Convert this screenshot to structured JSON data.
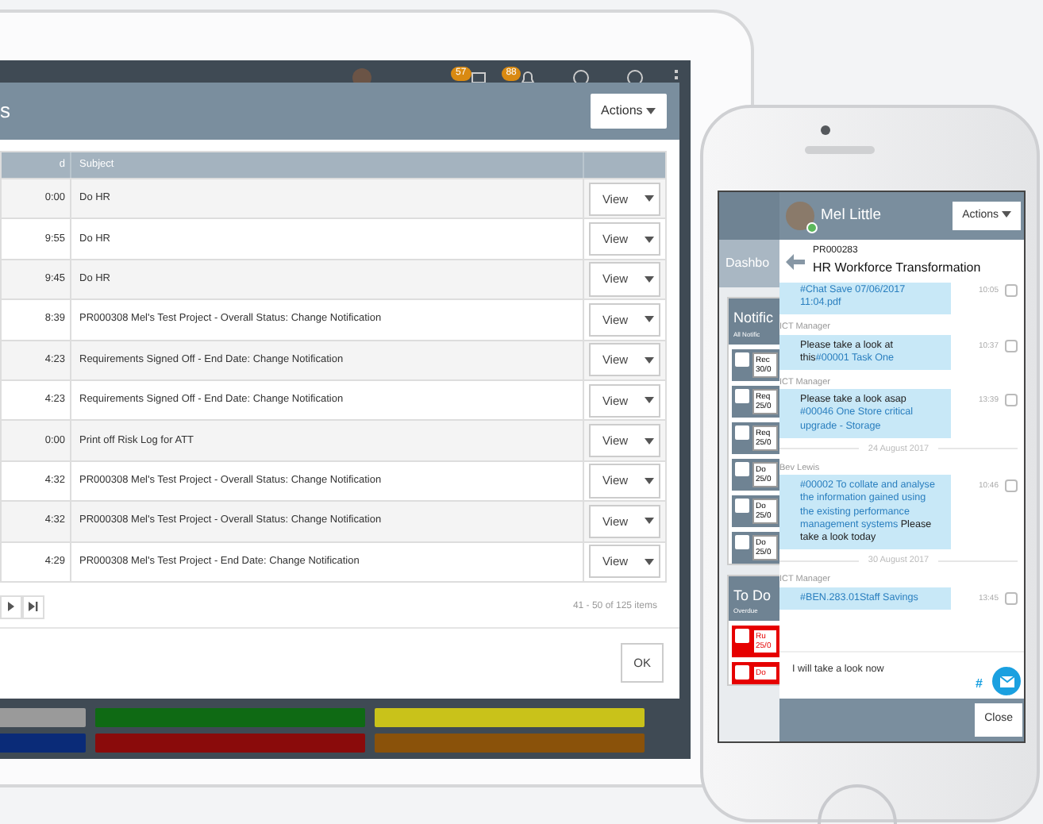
{
  "tablet": {
    "top_bar": {
      "badges": [
        "57",
        "88"
      ]
    },
    "modal": {
      "title": "s",
      "actions_button": "Actions",
      "columns": [
        "d",
        "Subject"
      ],
      "rows": [
        {
          "time": "0:00",
          "subject": "Do HR",
          "button": "View"
        },
        {
          "time": "9:55",
          "subject": "Do HR",
          "button": "View"
        },
        {
          "time": "9:45",
          "subject": "Do HR",
          "button": "View"
        },
        {
          "time": "8:39",
          "subject": "PR000308 Mel's Test Project - Overall Status: Change Notification",
          "button": "View"
        },
        {
          "time": "4:23",
          "subject": "Requirements Signed Off - End Date: Change Notification",
          "button": "View"
        },
        {
          "time": "4:23",
          "subject": "Requirements Signed Off - End Date: Change Notification",
          "button": "View"
        },
        {
          "time": "0:00",
          "subject": "Print off Risk Log for ATT",
          "button": "View"
        },
        {
          "time": "4:32",
          "subject": "PR000308 Mel's Test Project - Overall Status: Change Notification",
          "button": "View"
        },
        {
          "time": "4:32",
          "subject": "PR000308 Mel's Test Project - Overall Status: Change Notification",
          "button": "View"
        },
        {
          "time": "4:29",
          "subject": "PR000308 Mel's Test Project - End Date: Change Notification",
          "button": "View"
        }
      ],
      "pager": {
        "summary": "41 - 50 of 125 items"
      },
      "ok_button": "OK"
    },
    "tiles": [
      {
        "color": "#9a9a9a"
      },
      {
        "color": "#0f6a14"
      },
      {
        "color": "#c9c21a"
      },
      {
        "color": "#0a2b78"
      },
      {
        "color": "#8a0b0b"
      },
      {
        "color": "#8a520a"
      }
    ]
  },
  "phone": {
    "dashboard": {
      "title": "Dashbo",
      "panels": [
        {
          "title": "Notific",
          "subtitle": "All Notific",
          "items": [
            {
              "text": "Rec",
              "date": "30/0",
              "color": "#6f8393"
            },
            {
              "text": "Req",
              "date": "25/0",
              "color": "#6f8393"
            },
            {
              "text": "Req",
              "date": "25/0",
              "color": "#6f8393"
            },
            {
              "text": "Do",
              "date": "25/0",
              "color": "#6f8393"
            },
            {
              "text": "Do",
              "date": "25/0",
              "color": "#6f8393"
            },
            {
              "text": "Do",
              "date": "25/0",
              "color": "#6f8393"
            }
          ]
        },
        {
          "title": "To Do",
          "subtitle": "Overdue",
          "items": [
            {
              "text": "Ru",
              "date": "25/0",
              "color": "#e60000"
            },
            {
              "text": "Do",
              "color": "#e60000"
            }
          ]
        }
      ]
    },
    "chat": {
      "user": "Mel Little",
      "online": true,
      "actions_button": "Actions",
      "project_code": "PR000283",
      "project_title": "HR Workforce Transformation",
      "items": [
        {
          "kind": "message",
          "parts": [
            {
              "text": "#Chat Save 07/06/2017 11:04.pdf",
              "tag": true
            }
          ],
          "time": "10:05",
          "checked": false
        },
        {
          "kind": "message",
          "sender": "ICT Manager",
          "parts": [
            {
              "text": "Please take a look at this",
              "tag": false
            },
            {
              "text": "#00001 Task One",
              "tag": true
            }
          ],
          "time": "10:37",
          "checked": false
        },
        {
          "kind": "message",
          "sender": "ICT Manager",
          "parts": [
            {
              "text": "Please take a look asap ",
              "tag": false
            },
            {
              "text": "#00046 One Store critical upgrade - Storage",
              "tag": true
            }
          ],
          "time": "13:39",
          "checked": false
        },
        {
          "kind": "date",
          "text": "24 August 2017"
        },
        {
          "kind": "message",
          "sender": "Bev Lewis",
          "parts": [
            {
              "text": "#00002 To collate and analyse the information gained using the existing performance management systems",
              "tag": true
            },
            {
              "text": " Please take a look today",
              "tag": false
            }
          ],
          "time": "10:46",
          "checked": false
        },
        {
          "kind": "date",
          "text": "30 August 2017"
        },
        {
          "kind": "message",
          "sender": "ICT Manager",
          "parts": [
            {
              "text": "#BEN.283.01Staff Savings",
              "tag": true
            }
          ],
          "time": "13:45",
          "checked": false
        }
      ],
      "reply": "I will take a look now",
      "hash": "#",
      "close_button": "Close"
    }
  }
}
